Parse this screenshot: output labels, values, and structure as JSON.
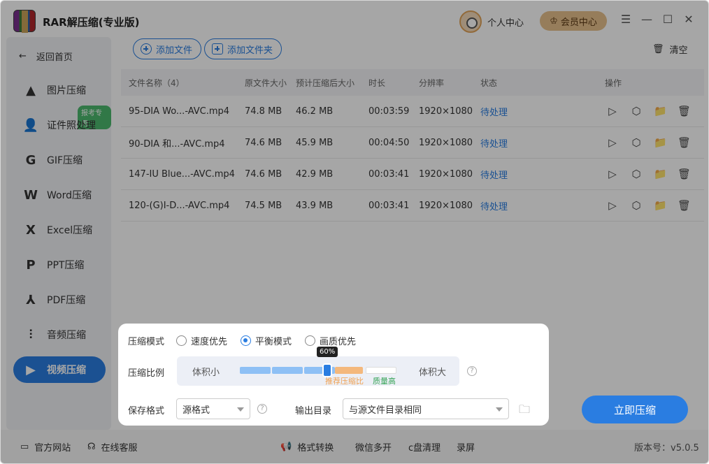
{
  "app": {
    "title": "RAR解压缩(专业版)"
  },
  "header": {
    "user_center": "个人中心",
    "vip_center": "会员中心"
  },
  "sidebar": {
    "back": "返回首页",
    "badge": "报考专用",
    "items": [
      {
        "label": "图片压缩",
        "icon": "image-icon"
      },
      {
        "label": "证件照处理",
        "icon": "id-photo-icon"
      },
      {
        "label": "GIF压缩",
        "icon": "gif-icon"
      },
      {
        "label": "Word压缩",
        "icon": "word-icon"
      },
      {
        "label": "Excel压缩",
        "icon": "excel-icon"
      },
      {
        "label": "PPT压缩",
        "icon": "ppt-icon"
      },
      {
        "label": "PDF压缩",
        "icon": "pdf-icon"
      },
      {
        "label": "音频压缩",
        "icon": "audio-icon"
      },
      {
        "label": "视频压缩",
        "icon": "video-icon"
      }
    ]
  },
  "toolbar": {
    "add_file": "添加文件",
    "add_folder": "添加文件夹",
    "clear": "清空"
  },
  "table": {
    "headers": [
      "文件名称（4）",
      "原文件大小",
      "预计压缩后大小",
      "时长",
      "分辨率",
      "状态",
      "操作"
    ],
    "rows": [
      {
        "name": "95-DIA Wo...-AVC.mp4",
        "size": "74.8 MB",
        "est": "46.2 MB",
        "duration": "00:03:59",
        "res": "1920×1080",
        "status": "待处理"
      },
      {
        "name": "90-DIA 和...-AVC.mp4",
        "size": "74.6 MB",
        "est": "45.9 MB",
        "duration": "00:04:50",
        "res": "1920×1080",
        "status": "待处理"
      },
      {
        "name": "147-IU Blue...-AVC.mp4",
        "size": "74.6 MB",
        "est": "42.9 MB",
        "duration": "00:03:41",
        "res": "1920×1080",
        "status": "待处理"
      },
      {
        "name": "120-(G)I-D...-AVC.mp4",
        "size": "74.5 MB",
        "est": "43.9 MB",
        "duration": "00:03:41",
        "res": "1920×1080",
        "status": "待处理"
      }
    ]
  },
  "panel": {
    "mode_label": "压缩模式",
    "modes": [
      "速度优先",
      "平衡模式",
      "画质优先"
    ],
    "selected_mode": "平衡模式",
    "ratio_label": "压缩比例",
    "ratio_small": "体积小",
    "ratio_large": "体积大",
    "ratio_value": "60%",
    "recommend": "推荐压缩比",
    "quality_high": "质量高",
    "format_label": "保存格式",
    "format_value": "源格式",
    "output_label": "输出目录",
    "output_value": "与源文件目录相同"
  },
  "start_button": "立即压缩",
  "footer": {
    "website": "官方网站",
    "service": "在线客服",
    "tools": [
      "格式转换",
      "微信多开",
      "c盘清理",
      "录屏"
    ],
    "version": "版本号：v5.0.5"
  },
  "colors": {
    "accent": "#2a7de1",
    "vip": "#e7c08d",
    "recommend": "#f0a050",
    "quality": "#3aa55a"
  }
}
